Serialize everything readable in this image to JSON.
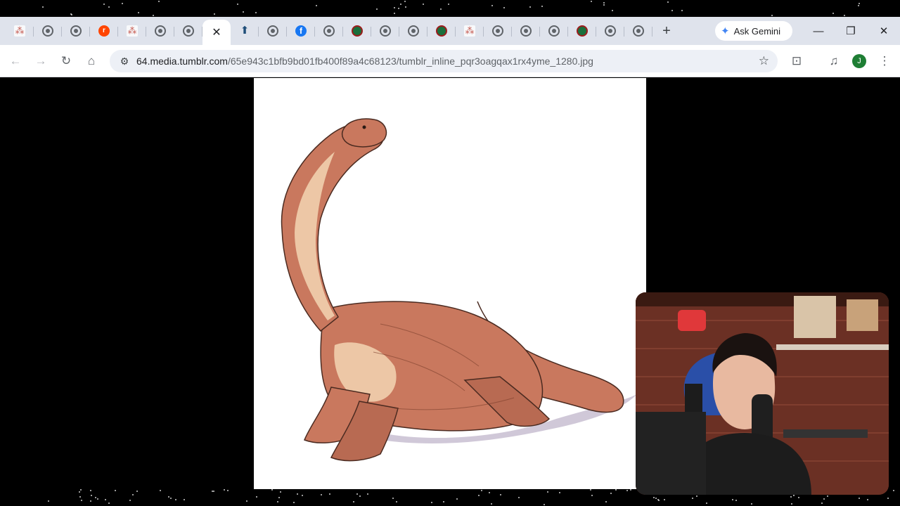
{
  "browser": {
    "tabs": [
      {
        "icon": "star-logo-icon",
        "glyph": "⁂"
      },
      {
        "icon": "globe-icon",
        "glyph": ""
      },
      {
        "icon": "globe-icon",
        "glyph": ""
      },
      {
        "icon": "reddit-icon",
        "glyph": "r"
      },
      {
        "icon": "star-logo-icon",
        "glyph": "⁂"
      },
      {
        "icon": "globe-icon",
        "glyph": ""
      },
      {
        "icon": "globe-icon",
        "glyph": ""
      },
      {
        "icon": "close-icon",
        "glyph": "✕",
        "active": true
      },
      {
        "icon": "arrow-logo-icon",
        "glyph": "⬆"
      },
      {
        "icon": "globe-icon",
        "glyph": ""
      },
      {
        "icon": "facebook-icon",
        "glyph": "f"
      },
      {
        "icon": "globe-icon",
        "glyph": ""
      },
      {
        "icon": "wikipedia-icon",
        "glyph": ""
      },
      {
        "icon": "globe-icon",
        "glyph": ""
      },
      {
        "icon": "globe-icon",
        "glyph": ""
      },
      {
        "icon": "wikipedia-icon",
        "glyph": ""
      },
      {
        "icon": "star-logo-icon",
        "glyph": "⁂"
      },
      {
        "icon": "globe-icon",
        "glyph": ""
      },
      {
        "icon": "globe-icon",
        "glyph": ""
      },
      {
        "icon": "globe-icon",
        "glyph": ""
      },
      {
        "icon": "wikipedia-icon",
        "glyph": ""
      },
      {
        "icon": "globe-icon",
        "glyph": ""
      },
      {
        "icon": "globe-icon",
        "glyph": ""
      }
    ],
    "new_tab_glyph": "+",
    "gemini_label": "Ask Gemini",
    "gemini_glyph": "✦",
    "window_controls": {
      "minimize": "—",
      "restore": "❐",
      "close": "✕"
    },
    "toolbar": {
      "back_glyph": "←",
      "forward_glyph": "→",
      "reload_glyph": "↻",
      "home_glyph": "⌂",
      "tune_glyph": "⚙",
      "star_glyph": "☆",
      "lens_glyph": "⊡",
      "media_glyph": "♫",
      "menu_glyph": "⋮"
    },
    "url_host": "64.media.tumblr.com",
    "url_path": "/65e943c1bfb9bd01fb400f89a4c68123/tumblr_inline_pqr3oagqax1rx4yme_1280.jpg",
    "profile_initial": "J"
  },
  "colors": {
    "tabstrip": "#dfe3ec",
    "omnibox": "#edf0f6",
    "dinosaur_skin": "#c9785e",
    "dinosaur_belly": "#f1cfae",
    "shadow": "#a99bb8"
  }
}
